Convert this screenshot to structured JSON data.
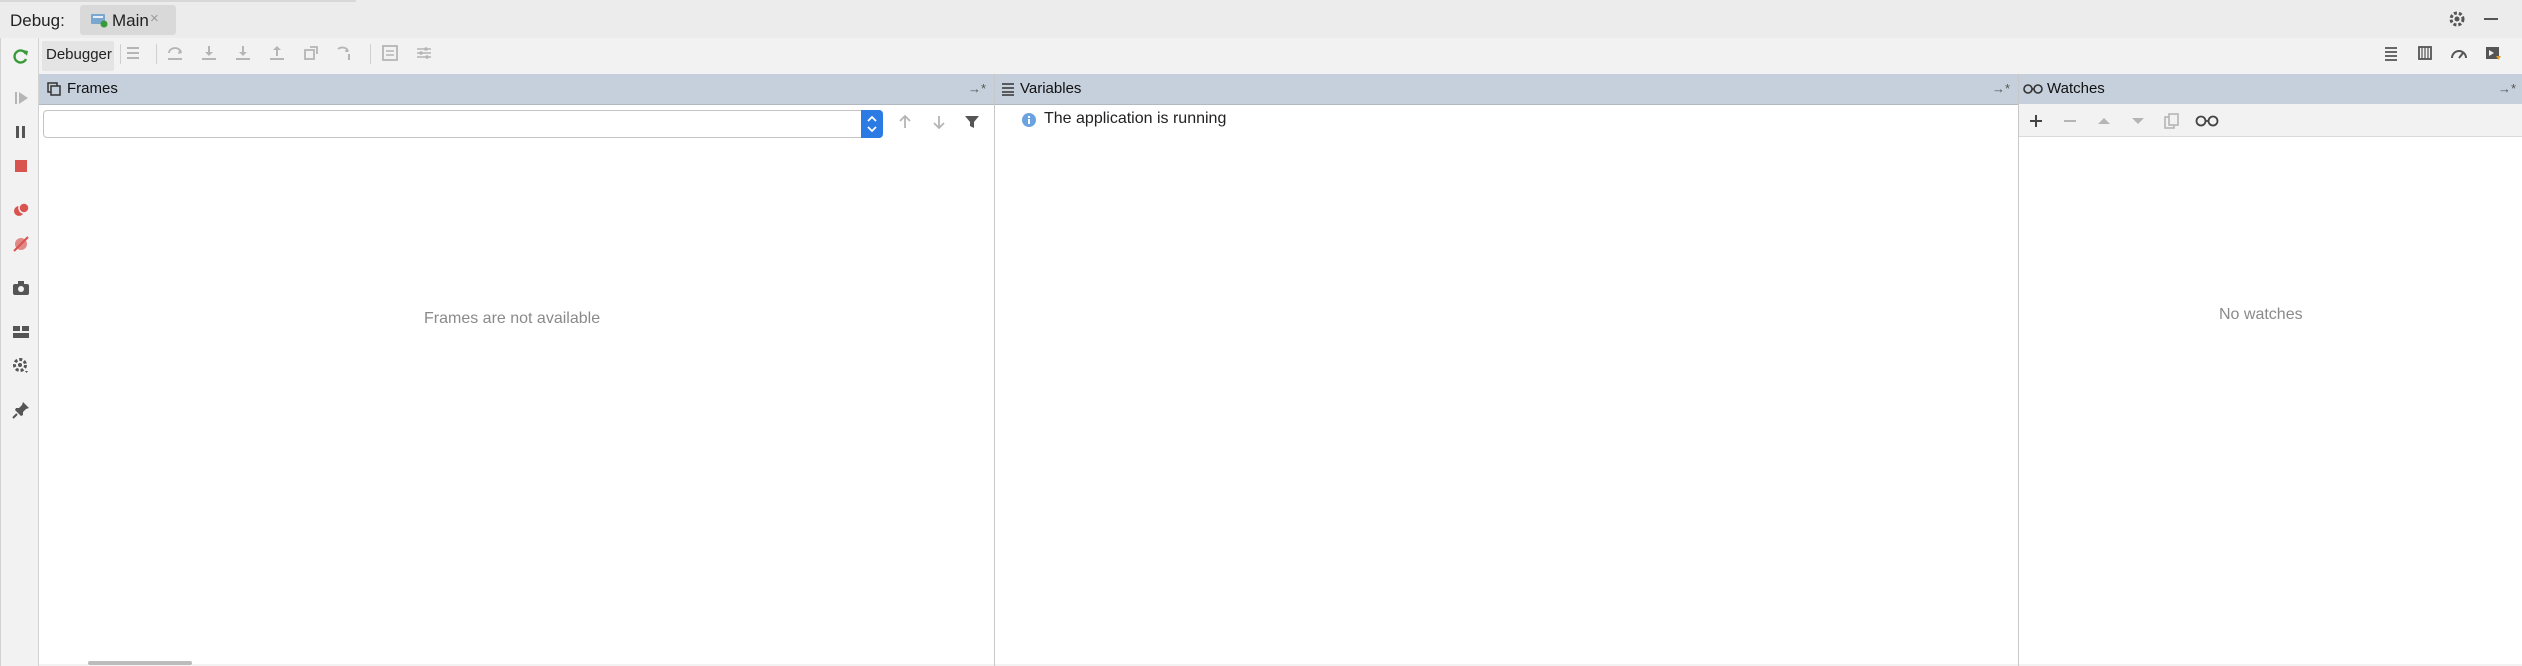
{
  "header": {
    "debug_label": "Debug:",
    "run_config_tab": "Main",
    "close_glyph": "×"
  },
  "toolbar": {
    "debugger_tab_label": "Debugger"
  },
  "frames": {
    "title": "Frames",
    "empty_text": "Frames are not available",
    "thread_select_value": ""
  },
  "variables": {
    "title": "Variables",
    "status_text": "The application is running"
  },
  "watches": {
    "title": "Watches",
    "empty_text": "No watches"
  },
  "colors": {
    "panel_header": "#c6d0dc",
    "select_accent": "#2c7be5",
    "stop_red": "#d9534f",
    "rerun_green": "#3a9a3a",
    "info_blue": "#6aa3e0"
  },
  "icons": {
    "left_toolbar": [
      "rerun-icon",
      "resume-icon",
      "pause-icon",
      "stop-icon",
      "view-breakpoints-icon",
      "mute-breakpoints-icon",
      "camera-icon",
      "layout-icon",
      "settings-icon",
      "pin-icon"
    ],
    "debug_toolbar": [
      "show-execution-point-icon",
      "step-over-icon",
      "step-into-icon",
      "force-step-into-icon",
      "step-out-icon",
      "drop-frame-icon",
      "run-to-cursor-icon",
      "evaluate-expression-icon",
      "trace-icon"
    ],
    "right_toolbar": [
      "list-icon",
      "memory-icon",
      "overhead-icon",
      "restore-layout-icon"
    ],
    "watches_toolbar": [
      "add-icon",
      "remove-icon",
      "move-up-icon",
      "move-down-icon",
      "copy-icon",
      "glasses-icon"
    ]
  }
}
